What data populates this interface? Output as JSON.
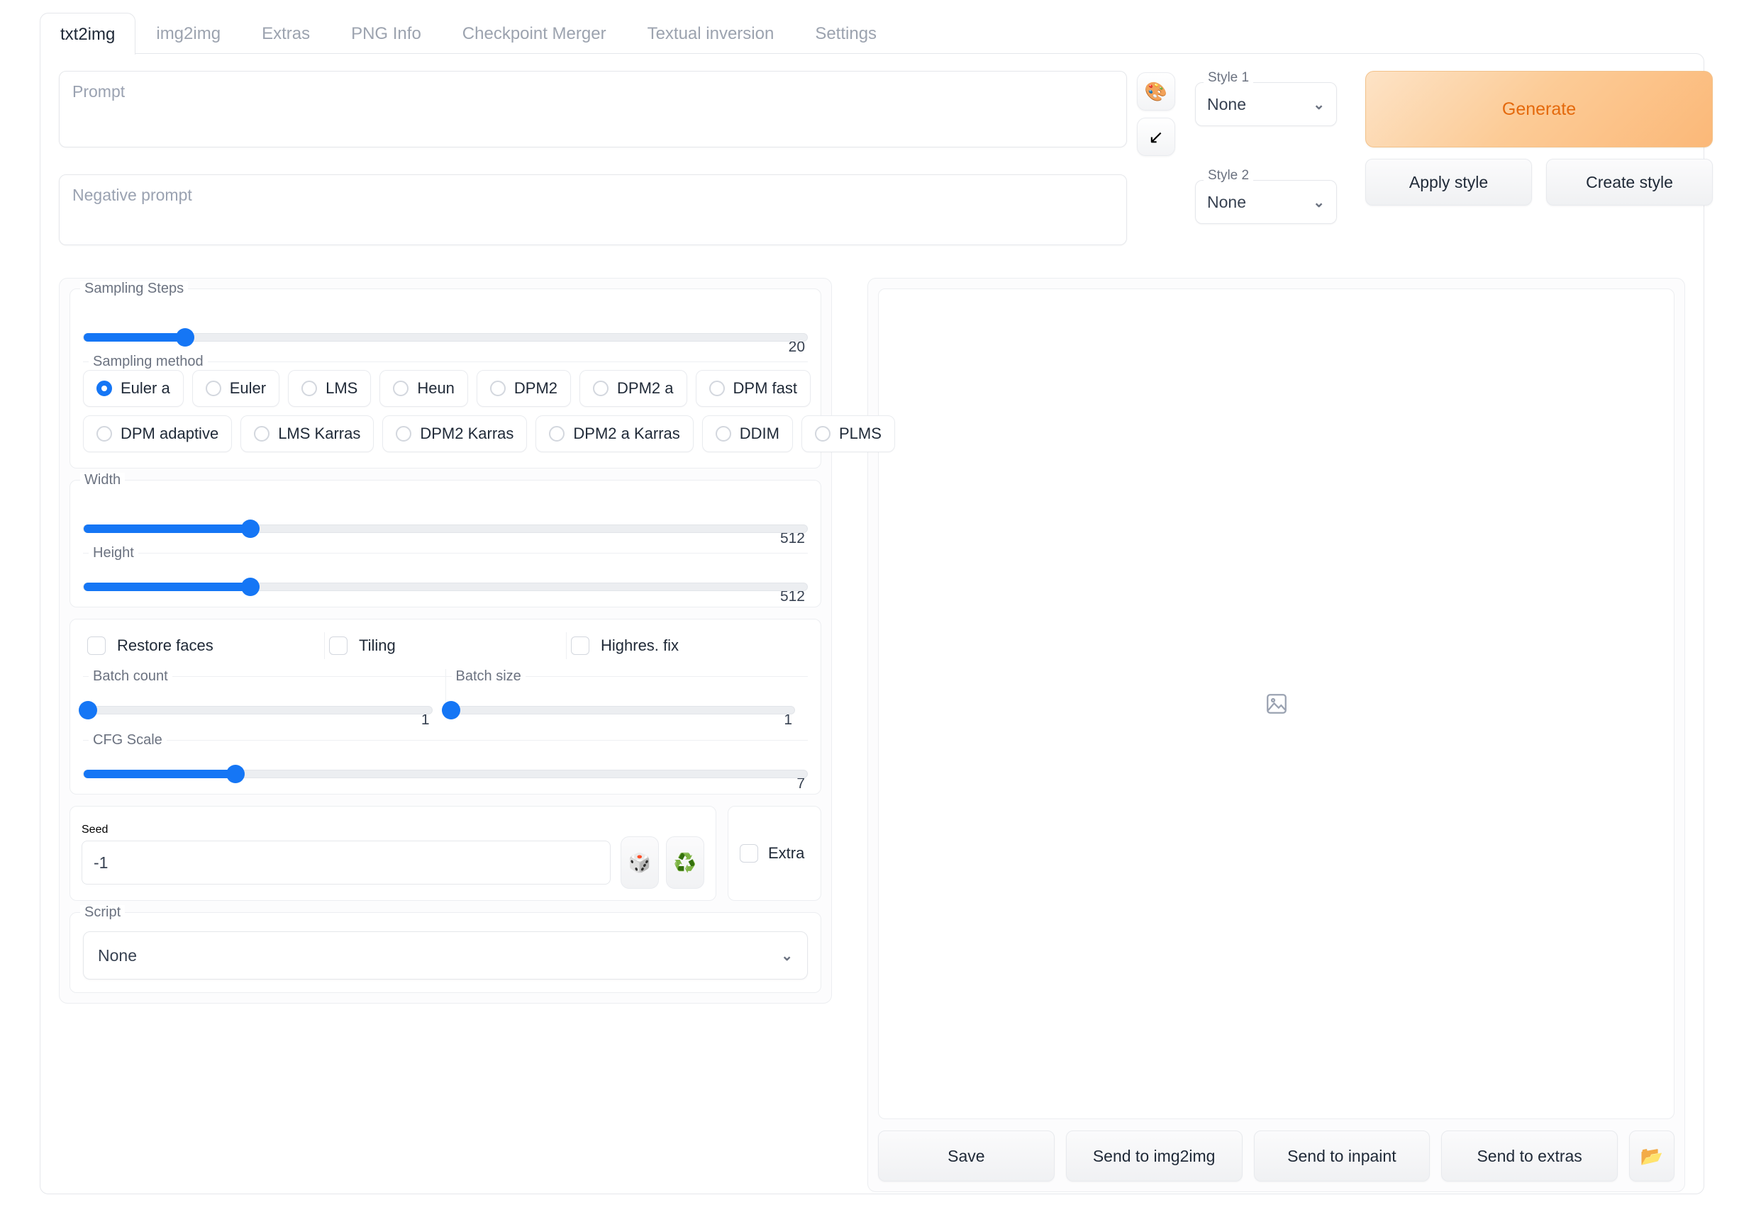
{
  "tabs": [
    {
      "label": "txt2img",
      "active": true
    },
    {
      "label": "img2img",
      "active": false
    },
    {
      "label": "Extras",
      "active": false
    },
    {
      "label": "PNG Info",
      "active": false
    },
    {
      "label": "Checkpoint Merger",
      "active": false
    },
    {
      "label": "Textual inversion",
      "active": false
    },
    {
      "label": "Settings",
      "active": false
    }
  ],
  "prompt": {
    "placeholder": "Prompt",
    "value": "",
    "negative_placeholder": "Negative prompt",
    "negative_value": ""
  },
  "prompt_icons": {
    "palette": "🎨",
    "arrow": "↙"
  },
  "styles": {
    "style1_label": "Style 1",
    "style1_value": "None",
    "style2_label": "Style 2",
    "style2_value": "None",
    "chevron": "⌄"
  },
  "actions": {
    "generate": "Generate",
    "apply_style": "Apply style",
    "create_style": "Create style",
    "generate_color": "#e4690c"
  },
  "sampling": {
    "steps_label": "Sampling Steps",
    "steps_value": "20",
    "steps_percent": 14,
    "method_label": "Sampling method",
    "methods_row1": [
      "Euler a",
      "Euler",
      "LMS",
      "Heun",
      "DPM2",
      "DPM2 a",
      "DPM fast"
    ],
    "methods_row2": [
      "DPM adaptive",
      "LMS Karras",
      "DPM2 Karras",
      "DPM2 a Karras",
      "DDIM",
      "PLMS"
    ],
    "selected": "Euler a"
  },
  "dimensions": {
    "width_label": "Width",
    "width_value": "512",
    "width_percent": 23,
    "height_label": "Height",
    "height_value": "512",
    "height_percent": 23
  },
  "toggles": [
    {
      "label": "Restore faces",
      "checked": false
    },
    {
      "label": "Tiling",
      "checked": false
    },
    {
      "label": "Highres. fix",
      "checked": false
    }
  ],
  "batch": {
    "count_label": "Batch count",
    "count_value": "1",
    "count_percent": 0,
    "size_label": "Batch size",
    "size_value": "1",
    "size_percent": 0
  },
  "cfg": {
    "label": "CFG Scale",
    "value": "7",
    "percent": 21
  },
  "seed": {
    "label": "Seed",
    "value": "-1",
    "dice_icon": "🎲",
    "recycle_icon": "♻️",
    "extra_label": "Extra",
    "extra_checked": false
  },
  "script": {
    "label": "Script",
    "value": "None",
    "chevron": "⌄"
  },
  "output": {
    "placeholder_icon": "image-placeholder",
    "buttons": [
      "Save",
      "Send to img2img",
      "Send to inpaint",
      "Send to extras"
    ],
    "folder_icon": "📂"
  },
  "colors": {
    "accent_blue": "#1576f5",
    "border": "#e5e7eb",
    "panel_bg": "#fcfcfd",
    "muted_text": "#6b7280"
  }
}
